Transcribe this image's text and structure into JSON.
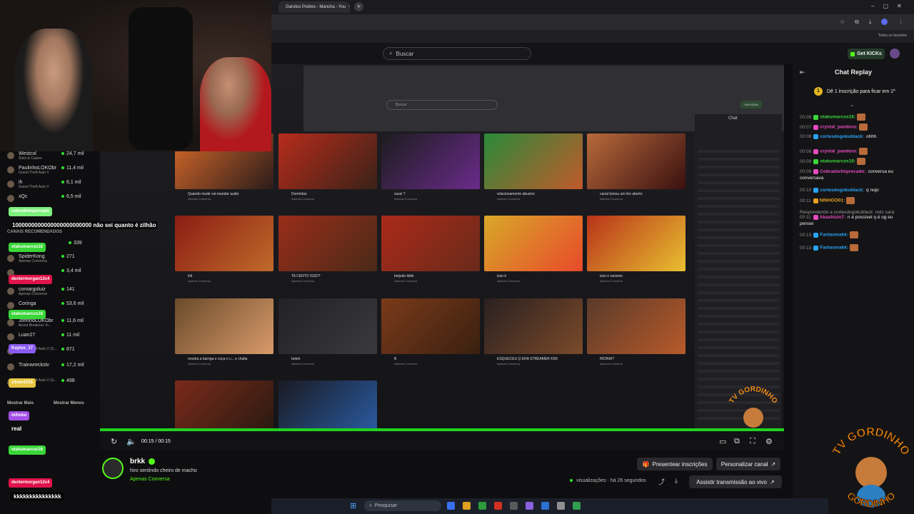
{
  "browser": {
    "tab_title": "Garotos Podres - Mancha - You",
    "new_tab": "+",
    "bookmarks_label": "Todos os favoritos"
  },
  "kick_header": {
    "search_placeholder": "Buscar",
    "get_kicks": "Get KICKs"
  },
  "inner_page": {
    "search_placeholder": "Buscar",
    "get_kicks": "Get KICKs",
    "chat_title": "Chat",
    "videos": [
      {
        "title": "Quando mude vai mandar audio",
        "channel": "Apenas Conversa"
      },
      {
        "title": "Dormidao",
        "channel": "Apenas Conversa"
      },
      {
        "title": "sussi ?",
        "channel": "Apenas Conversa"
      },
      {
        "title": "relacionamento abusivo",
        "channel": "Apenas Conversa"
      },
      {
        "title": "canal tomou um tiro aberto",
        "channel": "Apenas Conversa"
      },
      {
        "title": "loli",
        "channel": "Apenas Conversa"
      },
      {
        "title": "TA CERTO ISSO?",
        "channel": "Apenas Conversa"
      },
      {
        "title": "beijudo kkkk",
        "channel": "Apenas Conversa"
      },
      {
        "title": "isso é",
        "channel": "Apenas Conversa"
      },
      {
        "title": "isso e racismo",
        "channel": "Apenas Conversa"
      },
      {
        "title": "mostra a barriga e coça o c... e chalia",
        "channel": "Apenas Conversa"
      },
      {
        "title": "bebrk",
        "channel": "Apenas Conversa"
      },
      {
        "title": "lil",
        "channel": "Apenas Conversa"
      },
      {
        "title": "ESQUECEU Q ERA STREAMER KKK",
        "channel": "Apenas Conversa"
      },
      {
        "title": "IRONIA?",
        "channel": "Apenas Conversa"
      }
    ],
    "taskbar_search": "Pesquisar"
  },
  "player": {
    "time": "00:15 / 00:15"
  },
  "left_overlay": {
    "sidebar_rows": [
      {
        "name": "Westcol",
        "sub": "Slots & Casino",
        "count": "24,7 mil"
      },
      {
        "name": "PaulinhoLOKObr",
        "sub": "Grand Theft Auto V",
        "count": "11,4 mil"
      },
      {
        "name": "ih",
        "sub": "Grand Theft Auto V",
        "count": "6,1 mil"
      },
      {
        "name": "xQc",
        "sub": "",
        "count": "6,5 mil"
      },
      {
        "name": "SpiderKong",
        "sub": "Apenas Conversa",
        "count": "271"
      },
      {
        "name": "",
        "sub": "",
        "count": "3,4 mil"
      },
      {
        "name": "comargoluiz",
        "sub": "Apenas Conversa",
        "count": "141"
      },
      {
        "name": "Coringa",
        "sub": "",
        "count": "53,6 mil"
      },
      {
        "name": "JohnnoLOKObr",
        "sub": "Arena Breakout: In...",
        "count": "11,6 mil"
      },
      {
        "name": "Luan27",
        "sub": "",
        "count": "11 mil"
      },
      {
        "name": "",
        "sub": "Grand Theft Auto V (G...",
        "count": "871"
      },
      {
        "name": "Trainwreckstv",
        "sub": "",
        "count": "17,2 mil"
      },
      {
        "name": "",
        "sub": "Grand Theft Auto V (G...",
        "count": "498"
      }
    ],
    "recommended_label": "CANAIS RECOMENDADOS",
    "recommended_count": "339",
    "show_more": "Mostrar Mais",
    "show_less": "Mostrar Menos",
    "big_message": "1000000000000000000000000 não sei quanto é zilhão",
    "chat_pills": [
      {
        "name": "colcodeimpercado",
        "color": "#7df07d"
      },
      {
        "name": "otakumarcos16",
        "color": "#39d639"
      },
      {
        "name": "dextermorgan12x4",
        "color": "#e0134a"
      },
      {
        "name": "otakumarcos16",
        "color": "#39d639"
      },
      {
        "name": "Kaytox_17",
        "color": "#8a5cf0"
      },
      {
        "name": "zilnee1515",
        "color": "#e8c640"
      },
      {
        "name": "mihoku",
        "color": "#a450e6"
      },
      {
        "name": "otakumarcos16",
        "color": "#39d639"
      },
      {
        "name": "dextermorgan12x4",
        "color": "#e0134a"
      }
    ],
    "chat_texts": [
      "real",
      "kkkkkkkkkkkkkkk"
    ]
  },
  "chat_replay": {
    "title": "Chat Replay",
    "sub_banner": "Dê 1 inscrição para ficar em 1º",
    "sub_rank": "1",
    "messages": [
      {
        "time": "00:06",
        "user": "otakumarcos16:",
        "color": "#3bd63b",
        "text": ""
      },
      {
        "time": "00:07",
        "user": "crystal_pandora:",
        "color": "#e84ac0",
        "text": ""
      },
      {
        "time": "00:08",
        "user": "cortesdogokublack:",
        "color": "#2aa3f5",
        "text": "ohhh"
      },
      {
        "time": "00:08",
        "user": "crystal_pandora:",
        "color": "#e84ac0",
        "text": ""
      },
      {
        "time": "00:09",
        "user": "otakumarcos16:",
        "color": "#3bd63b",
        "text": ""
      },
      {
        "time": "00:09",
        "user": "CobradorImprecado:",
        "color": "#e84ac0",
        "text": "conversa eu conversava"
      },
      {
        "time": "00:10",
        "user": "cortesdogokublack:",
        "color": "#2aa3f5",
        "text": "q nojo"
      },
      {
        "time": "00:11",
        "user": "NINHOO01:",
        "color": "#e8a020",
        "text": ""
      },
      {
        "time": "",
        "user": "Respondendo a cortesdogokublack: mds cara",
        "color": "#999999",
        "text": ""
      },
      {
        "time": "00:11",
        "user": "Akashizin7:",
        "color": "#e84ac0",
        "text": "n é possível q é og eu pensei"
      },
      {
        "time": "00:13",
        "user": "Fantasmakk:",
        "color": "#2aa3f5",
        "text": ""
      },
      {
        "time": "00:13",
        "user": "Fantasmakk:",
        "color": "#2aa3f5",
        "text": ""
      }
    ]
  },
  "channel": {
    "name": "brkk",
    "title": "hiro sentindo cheiro de macho",
    "category": "Apenas Conversa",
    "views": "visualizações",
    "time_ago": "há 26 segundos",
    "present_subs": "Presentear inscrições",
    "customize": "Personalizar canal",
    "watch_live": "Assistir transmissão ao vivo"
  },
  "windows": {
    "search": "Pesquisar"
  },
  "logo": {
    "top_text": "TV GORDINHO",
    "bottom_text": "GORDINHO",
    "small_text": "TV GORDINHO"
  },
  "colors": {
    "kick_green": "#53fc18",
    "accent_progress": "#1fd21f"
  }
}
